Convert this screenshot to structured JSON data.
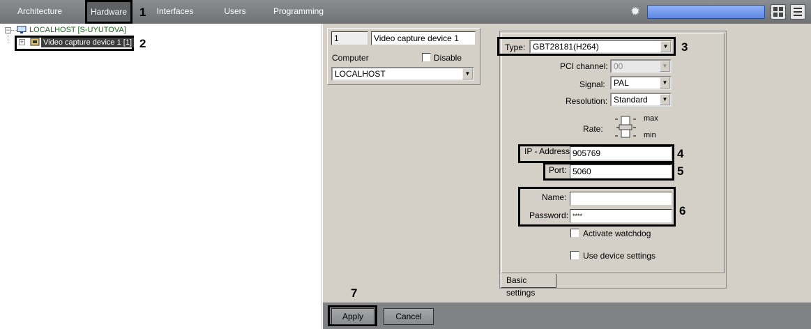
{
  "topbar": {
    "tabs": [
      {
        "label": "Architecture"
      },
      {
        "label": "Hardware"
      },
      {
        "label": "Interfaces"
      },
      {
        "label": "Users"
      },
      {
        "label": "Programming"
      }
    ],
    "icons": [
      "gear-icon",
      "layout-icon",
      "menu-icon"
    ]
  },
  "tree": {
    "root_label": "LOCALHOST [S-UYUTOVA]",
    "device_label": "Video capture device 1 [1]"
  },
  "device_header": {
    "id_value": "1",
    "name_value": "Video capture device 1",
    "computer_label": "Computer",
    "disable_label": "Disable",
    "computer_value": "LOCALHOST"
  },
  "settings": {
    "type_label": "Type:",
    "type_value": "GBT28181(H264)",
    "pci_label": "PCI channel:",
    "pci_value": "00",
    "signal_label": "Signal:",
    "signal_value": "PAL",
    "resolution_label": "Resolution:",
    "resolution_value": "Standard",
    "rate_label": "Rate:",
    "rate_max": "max",
    "rate_min": "min",
    "ip_label": "IP - Address:",
    "ip_value": "905769",
    "port_label": "Port:",
    "port_value": "5060",
    "name_label": "Name:",
    "name_value": "",
    "password_label": "Password:",
    "password_value": "****",
    "watchdog_label": "Activate watchdog",
    "use_device_label": "Use device settings",
    "tab_label": "Basic settings"
  },
  "buttons": {
    "apply": "Apply",
    "cancel": "Cancel"
  },
  "callouts": [
    "1",
    "2",
    "3",
    "4",
    "5",
    "6",
    "7"
  ],
  "colors": {
    "topbar": "#7b7d80",
    "panel": "#d4d0c8",
    "tree_text": "#1a6b1a",
    "selected_bg": "#3a3a3a",
    "search_blue": "#6d93ee"
  }
}
